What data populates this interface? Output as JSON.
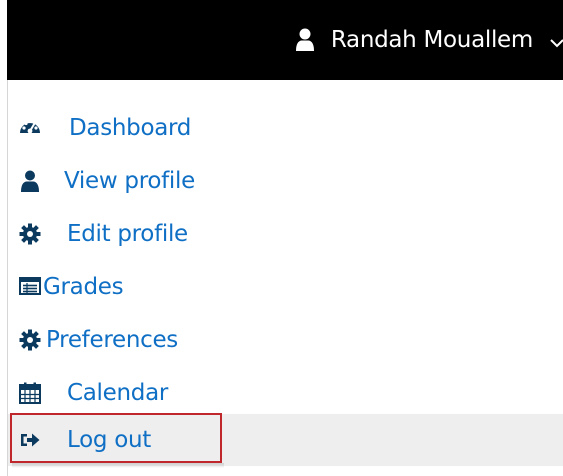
{
  "header": {
    "user_name": "Randah Mouallem",
    "user_icon": "user-icon",
    "toggle_icon": "chevron-down-icon"
  },
  "menu": {
    "items": [
      {
        "label": "Dashboard",
        "icon": "tachometer-icon"
      },
      {
        "label": "View profile",
        "icon": "user-icon"
      },
      {
        "label": "Edit profile",
        "icon": "cog-icon"
      },
      {
        "label": "Grades",
        "icon": "table-icon"
      },
      {
        "label": "Preferences",
        "icon": "cog-icon"
      },
      {
        "label": "Calendar",
        "icon": "calendar-icon"
      },
      {
        "label": "Log out",
        "icon": "sign-out-icon",
        "highlighted": true
      }
    ]
  },
  "colors": {
    "link": "#0f6fc5",
    "topbar": "#000000",
    "highlight_border": "#c0272d",
    "active_row": "#eeeeee"
  }
}
